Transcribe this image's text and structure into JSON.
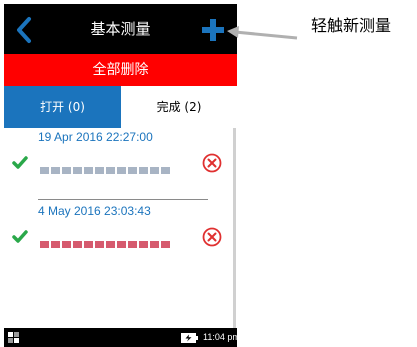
{
  "header": {
    "title": "基本测量",
    "back_icon": "chevron-left-icon",
    "add_icon": "plus-icon"
  },
  "delete_all_label": "全部删除",
  "tabs": [
    {
      "label": "打开 (0)",
      "active": true
    },
    {
      "label": "完成 (2)",
      "active": false
    }
  ],
  "measurements": [
    {
      "timestamp": "19 Apr 2016 22:27:00",
      "status_icon": "check-icon",
      "color": "#a8b4c4",
      "delete_icon": "delete-circle-icon"
    },
    {
      "timestamp": "4 May 2016 23:03:43",
      "status_icon": "check-icon",
      "color": "#d65a6e",
      "delete_icon": "delete-circle-icon"
    }
  ],
  "status_bar": {
    "time": "11:04 pm"
  },
  "callout": {
    "label": "轻触新测量"
  },
  "colors": {
    "accent": "#1b74bd",
    "danger": "#ff0000",
    "check": "#2aa84a"
  }
}
